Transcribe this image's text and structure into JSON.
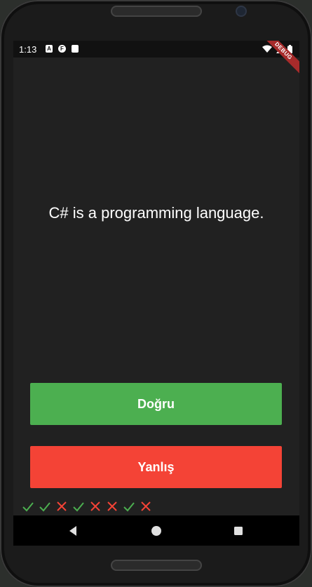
{
  "status_bar": {
    "time": "1:13",
    "debug_banner": "DEBUG",
    "notification_icons": [
      "a-icon",
      "f-icon",
      "sd-card-icon"
    ],
    "system_icons": [
      "wifi-icon",
      "signal-icon",
      "battery-icon"
    ]
  },
  "quiz": {
    "question": "C# is a programming language.",
    "true_label": "Doğru",
    "false_label": "Yanlış",
    "score_marks": [
      "check",
      "check",
      "cross",
      "check",
      "cross",
      "cross",
      "check",
      "cross"
    ]
  },
  "colors": {
    "background": "#212121",
    "true_button": "#4caf50",
    "false_button": "#f44336",
    "check": "#4caf50",
    "cross": "#f44336"
  },
  "nav_bar": {
    "buttons": [
      "back-icon",
      "home-icon",
      "recent-apps-icon"
    ]
  }
}
